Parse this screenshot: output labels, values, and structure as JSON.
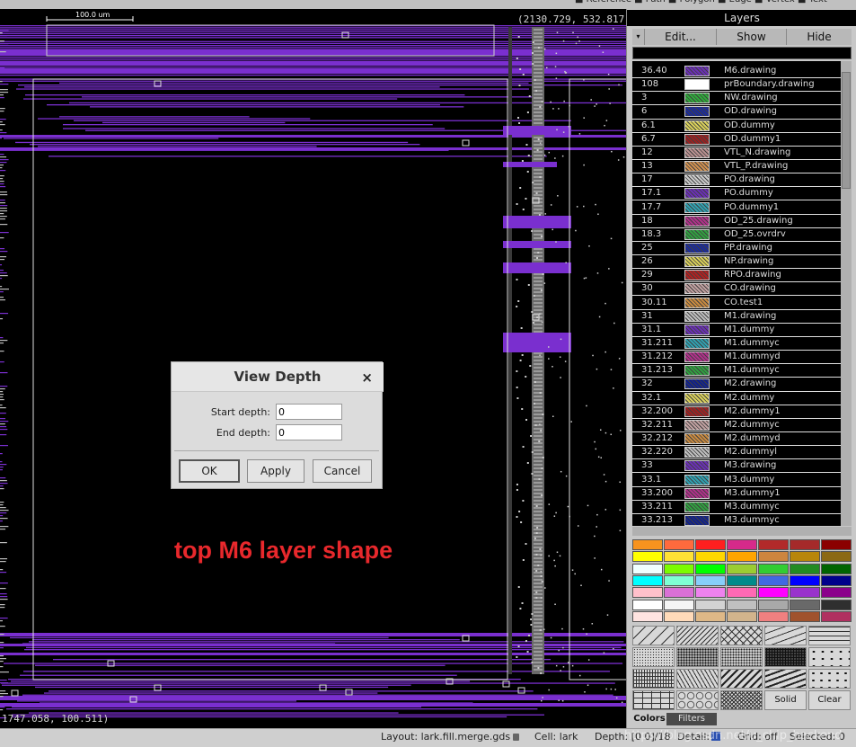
{
  "canvas": {
    "ruler_label": "100.0 um",
    "coord_top": "(2130.729, 532.817)",
    "coord_bottom": "1747.058, 100.511)",
    "annotation": "top M6 layer shape",
    "trace_color": "#7a2fcf"
  },
  "dialog": {
    "title": "View Depth",
    "close": "×",
    "start_label": "Start depth:",
    "start_value": "0",
    "end_label": "End depth:",
    "end_value": "0",
    "ok": "OK",
    "apply": "Apply",
    "cancel": "Cancel"
  },
  "layers_panel": {
    "title": "Layers",
    "toolbar": {
      "menu_arrow": "▾",
      "edit": "Edit...",
      "show": "Show",
      "hide": "Hide"
    },
    "layers": [
      {
        "num": "36.40",
        "name": "M6.drawing",
        "color": "#6a2fb5"
      },
      {
        "num": "108",
        "name": "prBoundary.drawing",
        "color": "#ffffff"
      },
      {
        "num": "3",
        "name": "NW.drawing",
        "color": "#2eaa3a"
      },
      {
        "num": "6",
        "name": "OD.drawing",
        "color": "#1a2a9a"
      },
      {
        "num": "6.1",
        "name": "OD.dummy",
        "color": "#d8cf5a"
      },
      {
        "num": "6.7",
        "name": "OD.dummy1",
        "color": "#9a2020"
      },
      {
        "num": "12",
        "name": "VTL_N.drawing",
        "color": "#b89090"
      },
      {
        "num": "13",
        "name": "VTL_P.drawing",
        "color": "#d09050"
      },
      {
        "num": "17",
        "name": "PO.drawing",
        "color": "#c8c8c8"
      },
      {
        "num": "17.1",
        "name": "PO.dummy",
        "color": "#6a2fb5"
      },
      {
        "num": "17.7",
        "name": "PO.dummy1",
        "color": "#30a0b0"
      },
      {
        "num": "18",
        "name": "OD_25.drawing",
        "color": "#b0308a"
      },
      {
        "num": "18.3",
        "name": "OD_25.ovrdrv",
        "color": "#30a040"
      },
      {
        "num": "25",
        "name": "PP.drawing",
        "color": "#1a2a9a"
      },
      {
        "num": "26",
        "name": "NP.drawing",
        "color": "#d8cf5a"
      },
      {
        "num": "29",
        "name": "RPO.drawing",
        "color": "#b02020"
      },
      {
        "num": "30",
        "name": "CO.drawing",
        "color": "#c0a0a0"
      },
      {
        "num": "30.11",
        "name": "CO.test1",
        "color": "#c88a40"
      },
      {
        "num": "31",
        "name": "M1.drawing",
        "color": "#bdbdbd"
      },
      {
        "num": "31.1",
        "name": "M1.dummy",
        "color": "#6a2fb5"
      },
      {
        "num": "31.211",
        "name": "M1.dummyc",
        "color": "#30a0b0"
      },
      {
        "num": "31.212",
        "name": "M1.dummyd",
        "color": "#b0308a"
      },
      {
        "num": "31.213",
        "name": "M1.dummyc",
        "color": "#30a040"
      },
      {
        "num": "32",
        "name": "M2.drawing",
        "color": "#10208a"
      },
      {
        "num": "32.1",
        "name": "M2.dummy",
        "color": "#d8cf5a"
      },
      {
        "num": "32.200",
        "name": "M2.dummy1",
        "color": "#a02020"
      },
      {
        "num": "32.211",
        "name": "M2.dummyc",
        "color": "#c0a0a0"
      },
      {
        "num": "32.212",
        "name": "M2.dummyd",
        "color": "#c88a40"
      },
      {
        "num": "32.220",
        "name": "M2.dummyl",
        "color": "#bdbdbd"
      },
      {
        "num": "33",
        "name": "M3.drawing",
        "color": "#6a2fb5"
      },
      {
        "num": "33.1",
        "name": "M3.dummy",
        "color": "#30a0b0"
      },
      {
        "num": "33.200",
        "name": "M3.dummy1",
        "color": "#b0308a"
      },
      {
        "num": "33.211",
        "name": "M3.dummyc",
        "color": "#30a040"
      },
      {
        "num": "33.213",
        "name": "M3.dummyc",
        "color": "#10208a"
      }
    ],
    "palette": [
      [
        "#f7931e",
        "#ff6a3d",
        "#ff1f1f",
        "#d62a8a",
        "#b22a2a",
        "#a52a2a",
        "#8b0000"
      ],
      [
        "#ffff00",
        "#ffe135",
        "#ffd700",
        "#ffa500",
        "#cd853f",
        "#b8860b",
        "#8b6914"
      ],
      [
        "#f0ffff",
        "#7cfc00",
        "#00ff00",
        "#9acd32",
        "#32cd32",
        "#228b22",
        "#006400"
      ],
      [
        "#00ffff",
        "#7fffd4",
        "#87cefa",
        "#008b8b",
        "#4169e1",
        "#0000ff",
        "#00008b"
      ],
      [
        "#ffc0cb",
        "#da70d6",
        "#ee82ee",
        "#ff69b4",
        "#ff00ff",
        "#9932cc",
        "#8b008b"
      ],
      [
        "#ffffff",
        "#f5f5f5",
        "#d3d3d3",
        "#c0c0c0",
        "#a9a9a9",
        "#696969",
        "#2f2f2f"
      ],
      [
        "#ffe4e1",
        "#ffdab9",
        "#deb887",
        "#d2b48c",
        "#f08080",
        "#a0522d",
        "#b03060"
      ]
    ],
    "patterns": [
      "diag-sparse",
      "diag-dense",
      "diag-x",
      "diag-rev",
      "wave",
      "dots-fine",
      "dots",
      "dots-dense",
      "dots-coarse",
      "dots-arrow",
      "vlines",
      "zigzag",
      "diag-bold",
      "diag-bold-rev",
      "plus",
      "brick",
      "circles",
      "crosshatch"
    ],
    "solid": "Solid",
    "clear": "Clear",
    "tabs": {
      "colors": "Colors",
      "filters": "Filters"
    }
  },
  "status": {
    "layout": "Layout: lark.fill.merge.gds",
    "cell": "Cell: lark",
    "depth": "Depth: [0 0]/18",
    "detail": "Detail:",
    "grid": "Grid: off",
    "selected": "Selected: 0",
    "watermark": "https://blog.csdn.net/u_chip_backend"
  }
}
